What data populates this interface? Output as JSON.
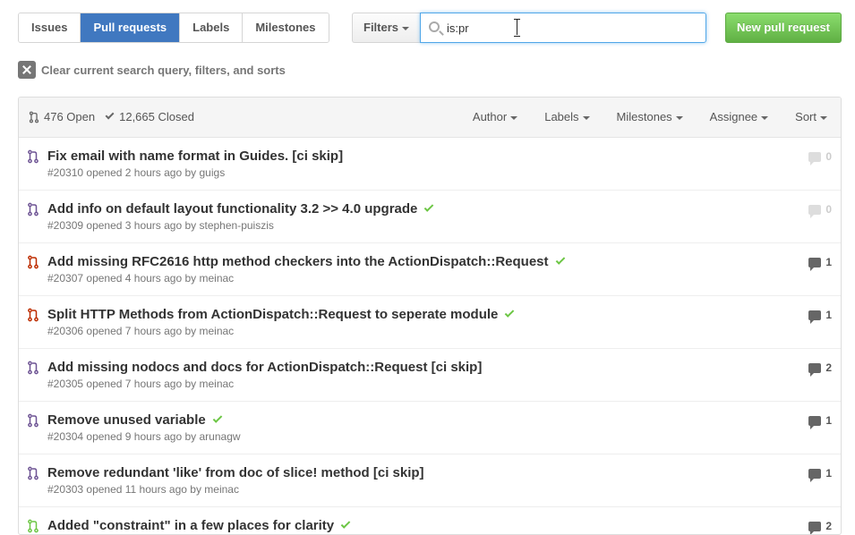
{
  "tabs": [
    "Issues",
    "Pull requests",
    "Labels",
    "Milestones"
  ],
  "filters_label": "Filters",
  "search": {
    "value": "is:pr "
  },
  "new_pr_label": "New pull request",
  "clear_label": "Clear current search query, filters, and sorts",
  "header": {
    "open": "476 Open",
    "closed": "12,665 Closed",
    "sorts": [
      "Author",
      "Labels",
      "Milestones",
      "Assignee",
      "Sort"
    ]
  },
  "colors": {
    "accent": "#4078c0",
    "green": "#6cc644",
    "open_icon": "#6e5494",
    "error_icon": "#bd2c00"
  },
  "prs": [
    {
      "title": "Fix email with name format in Guides. [ci skip]",
      "number": "#20310",
      "opened": "opened 2 hours ago by",
      "user": "guigs",
      "comments": "0",
      "check": false,
      "icon_color": "#6e5494"
    },
    {
      "title": "Add info on default layout functionality 3.2 >> 4.0 upgrade",
      "number": "#20309",
      "opened": "opened 3 hours ago by",
      "user": "stephen-puiszis",
      "comments": "0",
      "check": true,
      "icon_color": "#6e5494"
    },
    {
      "title": "Add missing RFC2616 http method checkers into the ActionDispatch::Request",
      "number": "#20307",
      "opened": "opened 4 hours ago by",
      "user": "meinac",
      "comments": "1",
      "check": true,
      "icon_color": "#bd2c00"
    },
    {
      "title": "Split HTTP Methods from ActionDispatch::Request to seperate module",
      "number": "#20306",
      "opened": "opened 7 hours ago by",
      "user": "meinac",
      "comments": "1",
      "check": true,
      "icon_color": "#bd2c00"
    },
    {
      "title": "Add missing nodocs and docs for ActionDispatch::Request [ci skip]",
      "number": "#20305",
      "opened": "opened 7 hours ago by",
      "user": "meinac",
      "comments": "2",
      "check": false,
      "icon_color": "#6e5494"
    },
    {
      "title": "Remove unused variable",
      "number": "#20304",
      "opened": "opened 9 hours ago by",
      "user": "arunagw",
      "comments": "1",
      "check": true,
      "icon_color": "#6e5494"
    },
    {
      "title": "Remove redundant 'like' from doc of slice! method [ci skip]",
      "number": "#20303",
      "opened": "opened 11 hours ago by",
      "user": "meinac",
      "comments": "1",
      "check": false,
      "icon_color": "#6e5494"
    },
    {
      "title": "Added \"constraint\" in a few places for clarity",
      "number": "",
      "opened": "",
      "user": "",
      "comments": "2",
      "check": true,
      "icon_color": "#6cc644"
    }
  ]
}
